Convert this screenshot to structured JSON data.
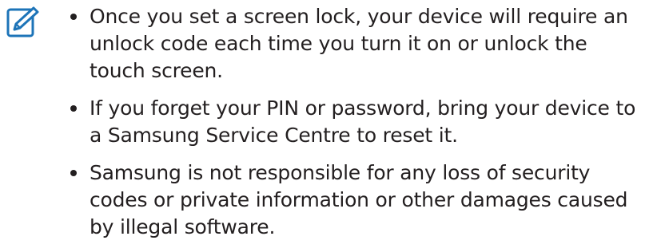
{
  "note": {
    "icon": "note-pencil-icon",
    "icon_color": "#1d74b8",
    "text_color": "#231f20",
    "items": [
      "Once you set a screen lock, your device will require an unlock code each time you turn it on or unlock the touch screen.",
      "If you forget your PIN or password, bring your device to a Samsung Service Centre to reset it.",
      "Samsung is not responsible for any loss of security codes or private information or other damages caused by illegal software."
    ]
  }
}
